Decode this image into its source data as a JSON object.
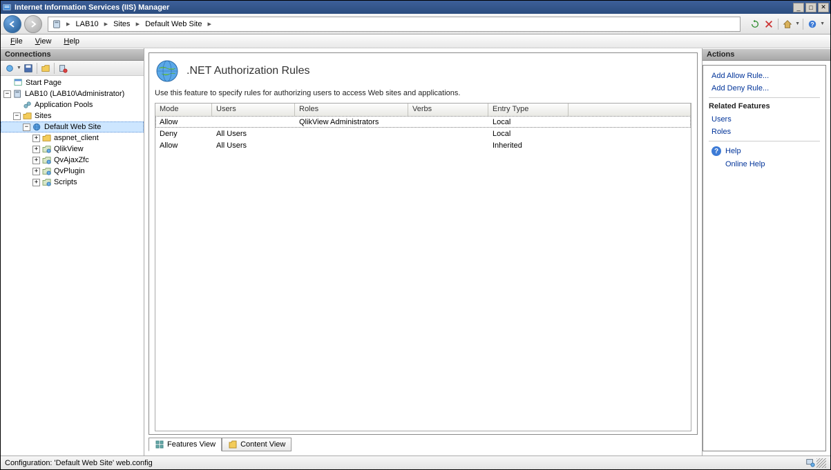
{
  "titlebar": {
    "title": "Internet Information Services (IIS) Manager"
  },
  "breadcrumb": {
    "segments": [
      "LAB10",
      "Sites",
      "Default Web Site"
    ]
  },
  "menubar": {
    "file": "File",
    "view": "View",
    "help": "Help"
  },
  "connections": {
    "title": "Connections",
    "tree": {
      "start_page": "Start Page",
      "server": "LAB10 (LAB10\\Administrator)",
      "app_pools": "Application Pools",
      "sites": "Sites",
      "default_site": "Default Web Site",
      "aspnet_client": "aspnet_client",
      "qlikview": "QlikView",
      "qvajaxzfc": "QvAjaxZfc",
      "qvplugin": "QvPlugin",
      "scripts": "Scripts"
    }
  },
  "feature": {
    "title": ".NET Authorization Rules",
    "description": "Use this feature to specify rules for authorizing users to access Web sites and applications.",
    "columns": {
      "mode": "Mode",
      "users": "Users",
      "roles": "Roles",
      "verbs": "Verbs",
      "entry": "Entry Type"
    },
    "rows": [
      {
        "mode": "Allow",
        "users": "",
        "roles": "QlikView Administrators",
        "verbs": "",
        "entry": "Local"
      },
      {
        "mode": "Deny",
        "users": "All Users",
        "roles": "",
        "verbs": "",
        "entry": "Local"
      },
      {
        "mode": "Allow",
        "users": "All Users",
        "roles": "",
        "verbs": "",
        "entry": "Inherited"
      }
    ]
  },
  "view_tabs": {
    "features": "Features View",
    "content": "Content View"
  },
  "actions": {
    "title": "Actions",
    "add_allow": "Add Allow Rule...",
    "add_deny": "Add Deny Rule...",
    "related": "Related Features",
    "users": "Users",
    "roles": "Roles",
    "help": "Help",
    "online_help": "Online Help"
  },
  "statusbar": {
    "text": "Configuration: 'Default Web Site' web.config"
  }
}
